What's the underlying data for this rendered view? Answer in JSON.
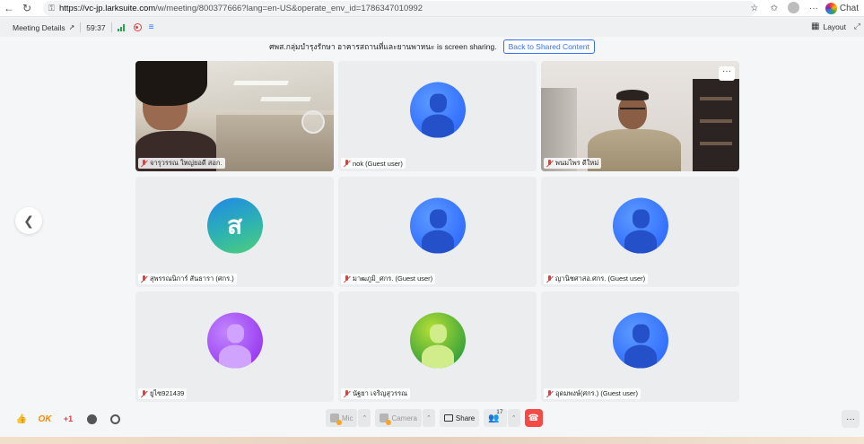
{
  "browser": {
    "url_host": "https://vc-jp.larksuite.com",
    "url_path": "/w/meeting/800377666?lang=en-US&operate_env_id=1786347010992",
    "chat_label": "Chat"
  },
  "header": {
    "meeting_details": "Meeting Details",
    "timer": "59:37",
    "layout_label": "Layout"
  },
  "banner": {
    "message": "ศพส.กลุ่มบำรุงรักษา อาคารสถานที่และยานพาหนะ is screen sharing.",
    "back_button": "Back to Shared Content"
  },
  "tiles": [
    {
      "name": "จารุวรรณ ใหญ่ยอดี สอก.",
      "kind": "video1"
    },
    {
      "name": "nok (Guest user)",
      "kind": "default"
    },
    {
      "name": "พนมไพร ดีใหม่",
      "kind": "video2"
    },
    {
      "name": "สุพรรณนิการ์ สันธารา (ศกร.)",
      "kind": "letter",
      "letter": "ส"
    },
    {
      "name": "มาฒภูมิ_ศกร. (Guest user)",
      "kind": "default"
    },
    {
      "name": "ญานิชศาสอ.ศกร. (Guest user)",
      "kind": "default"
    },
    {
      "name": "ยูไซ921439",
      "kind": "purple"
    },
    {
      "name": "นัฐยา เจริญสุวรรณ",
      "kind": "green"
    },
    {
      "name": "อุดมพงษ์(ศกร.) (Guest user)",
      "kind": "default"
    }
  ],
  "toolbar": {
    "ok_label": "OK",
    "plus_label": "+1",
    "mic_label": "Mic",
    "camera_label": "Camera",
    "share_label": "Share",
    "participants_count": "17"
  }
}
